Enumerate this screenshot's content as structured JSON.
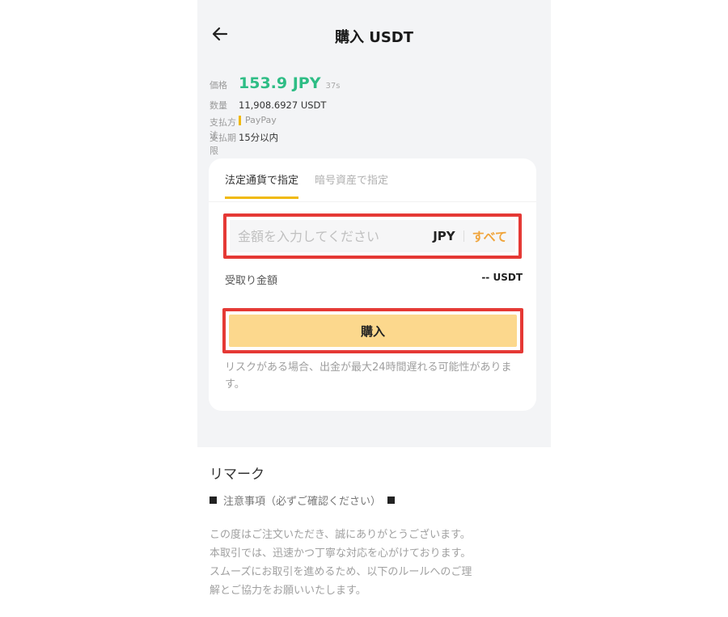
{
  "header": {
    "title": "購入 USDT"
  },
  "order": {
    "price_label": "価格",
    "price_value": "153.9 JPY",
    "timer": "37s",
    "quantity_label": "数量",
    "quantity_value": "11,908.6927 USDT",
    "payment_label": "支払方法",
    "payment_value": "PayPay",
    "deadline_label": "支払期限",
    "deadline_value": "15分以内"
  },
  "tabs": [
    {
      "label": "法定通貨で指定",
      "active": true
    },
    {
      "label": "暗号資産で指定",
      "active": false
    }
  ],
  "amount": {
    "placeholder": "金額を入力してください",
    "currency": "JPY",
    "all_label": "すべて"
  },
  "receive": {
    "label": "受取り金額",
    "value": "-- USDT"
  },
  "buy_button": {
    "label": "購入"
  },
  "notice": "リスクがある場合、出金が最大24時間遅れる可能性があります。",
  "remarks": {
    "title": "リマーク",
    "heading": "注意事項（必ずご確認ください）",
    "lines": [
      "この度はご注文いただき、誠にありがとうございます。",
      "本取引では、迅速かつ丁寧な対応を心がけております。",
      "スムーズにお取引を進めるため、以下のルールへのご理",
      "解とご協力をお願いいたします。"
    ]
  },
  "colors": {
    "accent": "#f0b90b",
    "price_green": "#2ebd85",
    "buy_button": "#fcd88d",
    "highlight_red": "#e53935"
  }
}
